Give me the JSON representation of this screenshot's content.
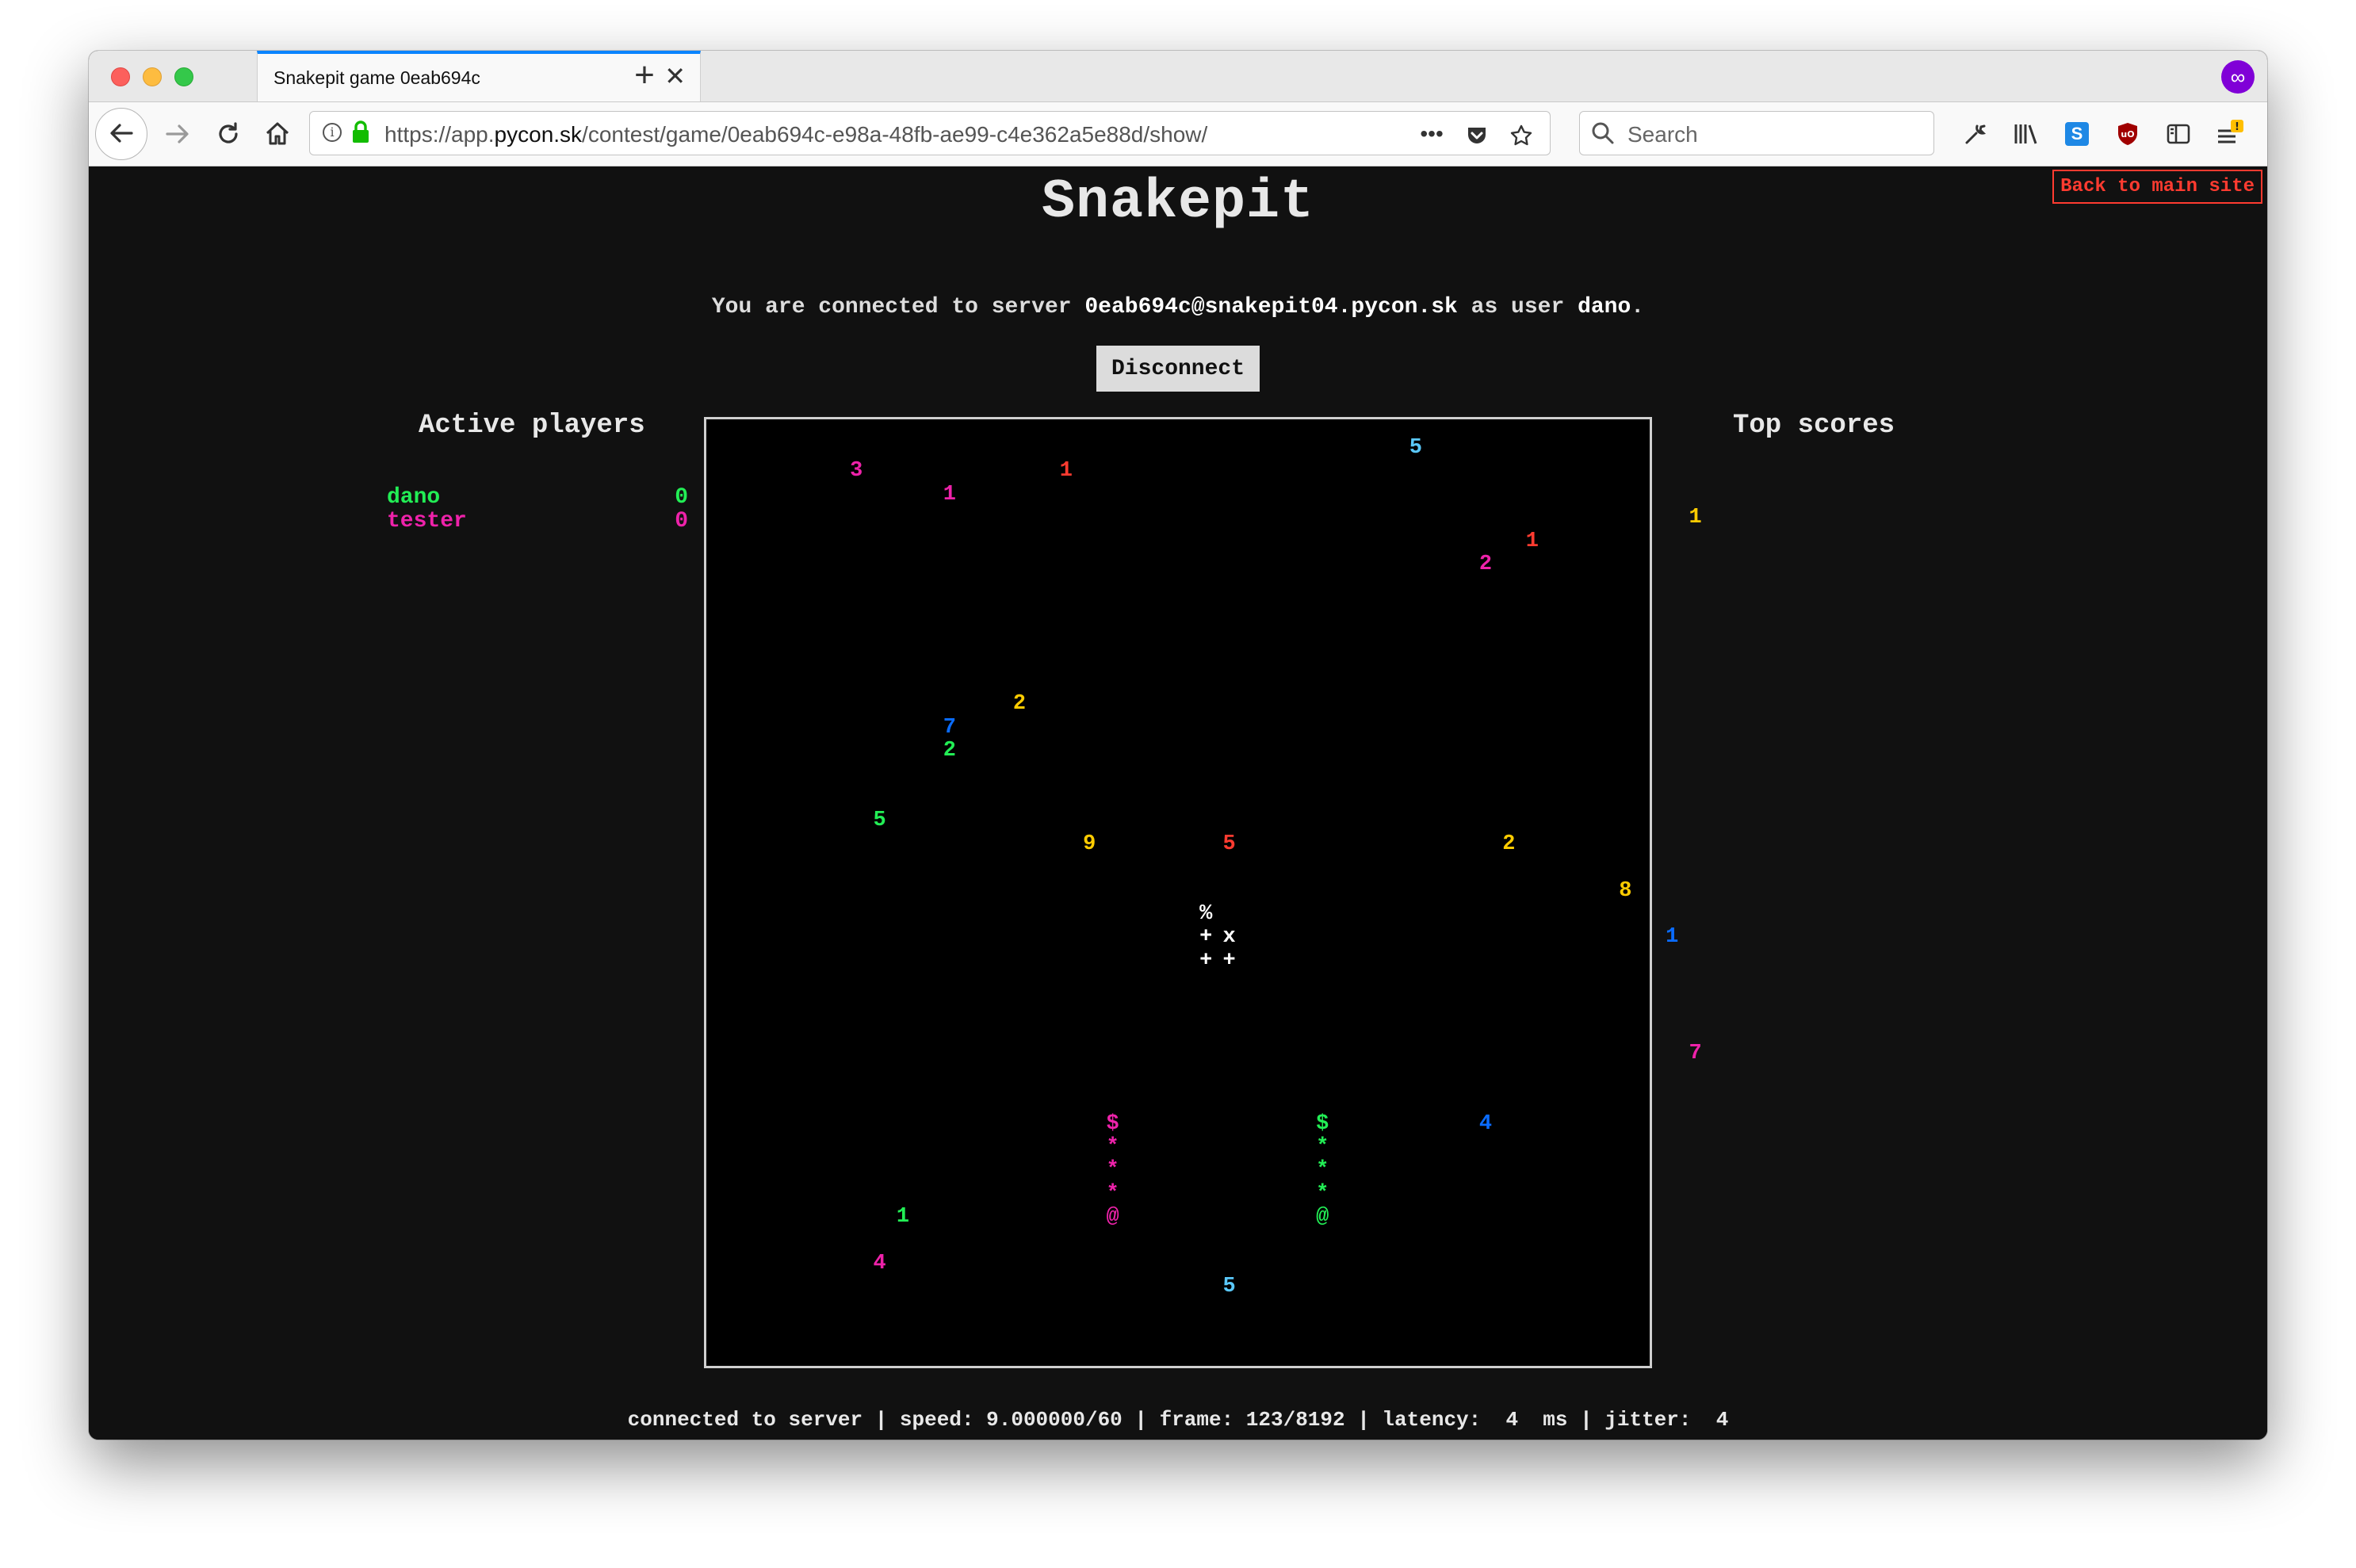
{
  "browser": {
    "tab_title": "Snakepit game 0eab694c",
    "tab_close": "✕",
    "new_tab": "+",
    "url_scheme": "https://app.",
    "url_host": "pycon.sk",
    "url_path": "/contest/game/0eab694c-e98a-48fb-ae99-c4e362a5e88d/show/",
    "search_placeholder": "Search"
  },
  "page": {
    "back_link": "Back to main site",
    "title": "Snakepit",
    "conn_prefix": "You are connected to server ",
    "server": "0eab694c@snakepit04.pycon.sk",
    "conn_mid": " as user ",
    "user": "dano",
    "conn_suffix": ".",
    "disconnect": "Disconnect",
    "active_players_heading": "Active players",
    "top_scores_heading": "Top scores",
    "status_bar": "connected to server | speed: 9.000000/60 | frame: 123/8192 | latency:  4  ms | jitter:  4"
  },
  "players": [
    {
      "name": "dano",
      "score": "0",
      "color": "#22ee55"
    },
    {
      "name": "tester",
      "score": "0",
      "color": "#ee22aa"
    }
  ],
  "board": {
    "grid_cols": 40,
    "grid_rows": 40,
    "cells": [
      {
        "ch": "5",
        "col": 27,
        "row": 0,
        "color": "#5ac8fa"
      },
      {
        "ch": "3",
        "col": 3,
        "row": 1,
        "color": "#ee22aa"
      },
      {
        "ch": "1",
        "col": 12,
        "row": 1,
        "color": "#ff3b30"
      },
      {
        "ch": "1",
        "col": 7,
        "row": 2,
        "color": "#ee22aa"
      },
      {
        "ch": "1",
        "col": 39,
        "row": 3,
        "color": "#ffcc00"
      },
      {
        "ch": "1",
        "col": 32,
        "row": 4,
        "color": "#ff3b30"
      },
      {
        "ch": "2",
        "col": 30,
        "row": 5,
        "color": "#ee22aa"
      },
      {
        "ch": "2",
        "col": 10,
        "row": 11,
        "color": "#ffcc00"
      },
      {
        "ch": "7",
        "col": 7,
        "row": 12,
        "color": "#0a6cff"
      },
      {
        "ch": "2",
        "col": 7,
        "row": 13,
        "color": "#22ee55"
      },
      {
        "ch": "5",
        "col": 4,
        "row": 16,
        "color": "#22ee55"
      },
      {
        "ch": "9",
        "col": 13,
        "row": 17,
        "color": "#ffcc00"
      },
      {
        "ch": "5",
        "col": 19,
        "row": 17,
        "color": "#ff3b30"
      },
      {
        "ch": "2",
        "col": 31,
        "row": 17,
        "color": "#ffcc00"
      },
      {
        "ch": "8",
        "col": 36,
        "row": 19,
        "color": "#ffcc00"
      },
      {
        "ch": "%",
        "col": 18,
        "row": 20,
        "color": "#ffffff"
      },
      {
        "ch": "+",
        "col": 18,
        "row": 21,
        "color": "#ffffff"
      },
      {
        "ch": "x",
        "col": 19,
        "row": 21,
        "color": "#ffffff"
      },
      {
        "ch": "1",
        "col": 38,
        "row": 21,
        "color": "#0a6cff"
      },
      {
        "ch": "+",
        "col": 18,
        "row": 22,
        "color": "#ffffff"
      },
      {
        "ch": "+",
        "col": 19,
        "row": 22,
        "color": "#ffffff"
      },
      {
        "ch": "7",
        "col": 39,
        "row": 26,
        "color": "#ee22aa"
      },
      {
        "ch": "$",
        "col": 14,
        "row": 29,
        "color": "#ee22aa"
      },
      {
        "ch": "$",
        "col": 23,
        "row": 29,
        "color": "#22ee55"
      },
      {
        "ch": "4",
        "col": 30,
        "row": 29,
        "color": "#0a6cff"
      },
      {
        "ch": "*",
        "col": 14,
        "row": 30,
        "color": "#ee22aa"
      },
      {
        "ch": "*",
        "col": 23,
        "row": 30,
        "color": "#22ee55"
      },
      {
        "ch": "*",
        "col": 14,
        "row": 31,
        "color": "#ee22aa"
      },
      {
        "ch": "*",
        "col": 23,
        "row": 31,
        "color": "#22ee55"
      },
      {
        "ch": "*",
        "col": 14,
        "row": 32,
        "color": "#ee22aa"
      },
      {
        "ch": "*",
        "col": 23,
        "row": 32,
        "color": "#22ee55"
      },
      {
        "ch": "1",
        "col": 5,
        "row": 33,
        "color": "#22ee55"
      },
      {
        "ch": "@",
        "col": 14,
        "row": 33,
        "color": "#ee22aa"
      },
      {
        "ch": "@",
        "col": 23,
        "row": 33,
        "color": "#22ee55"
      },
      {
        "ch": "4",
        "col": 4,
        "row": 35,
        "color": "#ee22aa"
      },
      {
        "ch": "5",
        "col": 19,
        "row": 36,
        "color": "#5ac8fa"
      }
    ]
  }
}
